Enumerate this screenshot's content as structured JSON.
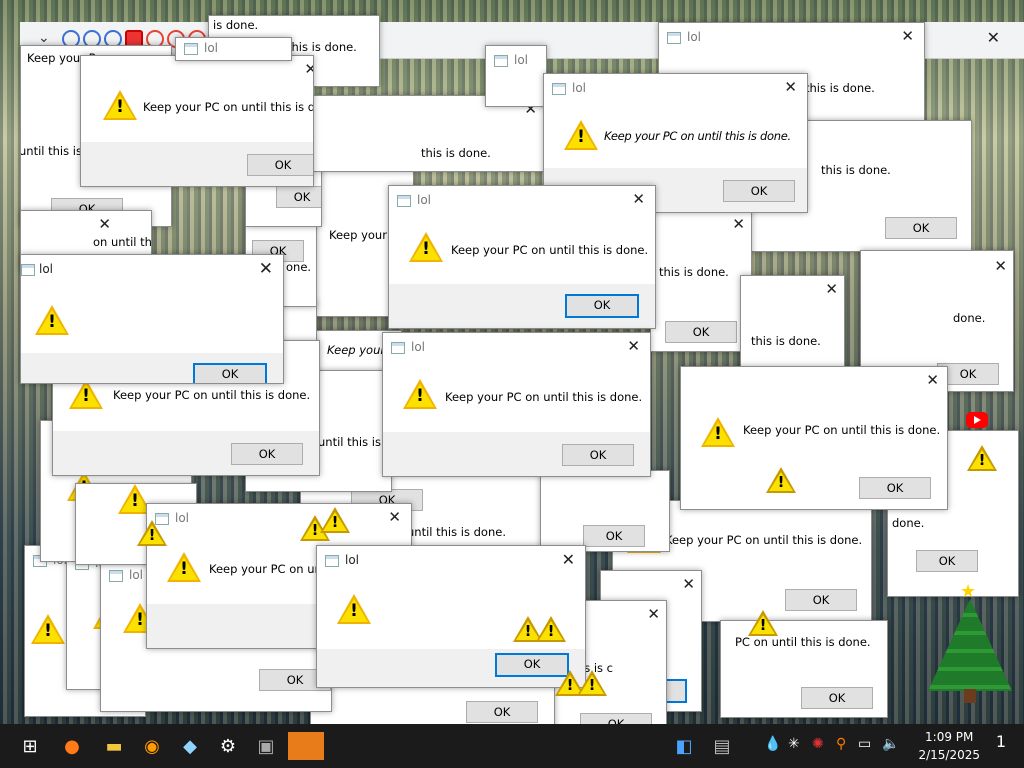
{
  "browser": {
    "chevron": "⌄",
    "close": "✕"
  },
  "dialog": {
    "title": "lol",
    "message": "Keep your PC on until this is done.",
    "ok_label": "OK",
    "close_glyph": "✕",
    "warning_glyph": "!"
  },
  "fragments": {
    "is_done": "is done.",
    "this_is_done": "this is done.",
    "keep_your_p": "Keep your P",
    "keep_your_pc_on": "Keep your PC on",
    "keep_your_pc_on_until": "Keep your PC on until",
    "until_this_is_c": "until this is c",
    "on_until_this_is_done": "on until this is done.",
    "this_is_c": "is is c",
    "keep_your": "Keep your",
    "ke": "Ke",
    "is_done_short": "is done.",
    "one": "one.",
    "pc_on_until": "PC on until this is done.",
    "this_is_done_2": "this is done.",
    "done": "done.",
    "until_this_is_done": "until this is done.",
    "on_until_this_is_done_2": "on until this is done.",
    "is_c": "is is c",
    "until_this": "until this is c",
    "done_dot": "done."
  },
  "taskbar": {
    "start_icon": "⊞",
    "time": "1:09 PM",
    "date": "2/15/2025",
    "notification_count": "1"
  },
  "colors": {
    "accent": "#0078d7",
    "warning": "#fce100",
    "taskbar": "#1b1b1b"
  }
}
